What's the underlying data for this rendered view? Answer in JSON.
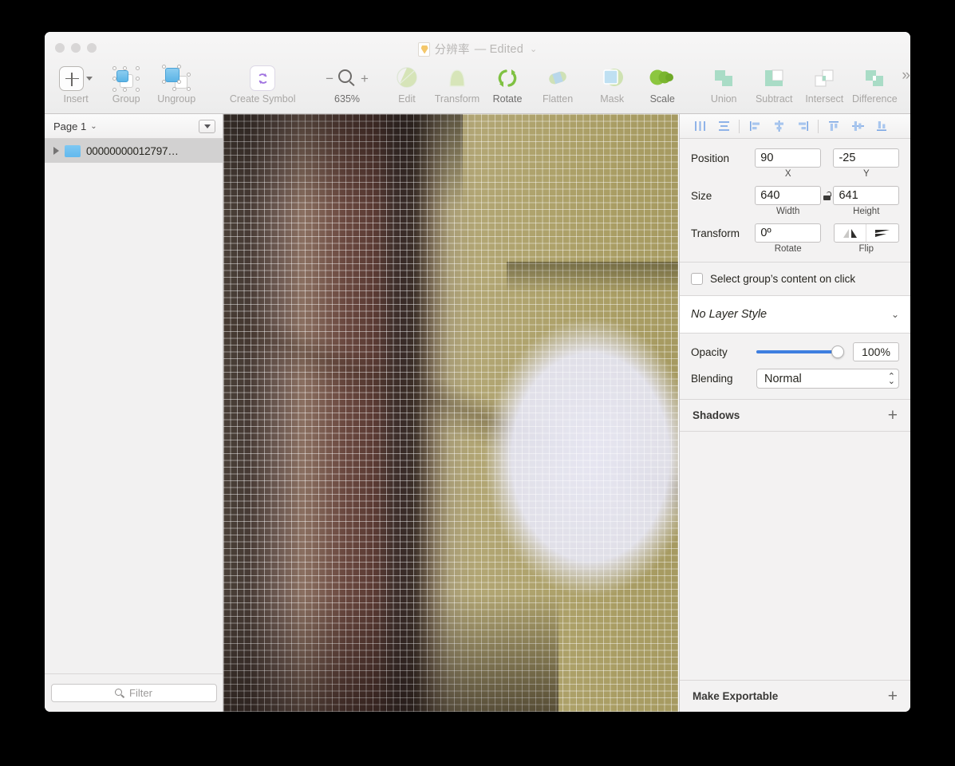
{
  "window": {
    "title": "分辨率",
    "title_suffix": "— Edited",
    "title_chevron": "⌄",
    "doc_icon": "sketch-document-icon"
  },
  "toolbar": {
    "items": [
      {
        "label": "Insert",
        "icon": "plus-icon",
        "enabled": false
      },
      {
        "label": "Group",
        "icon": "group-icon",
        "enabled": false
      },
      {
        "label": "Ungroup",
        "icon": "ungroup-icon",
        "enabled": false
      },
      {
        "label": "Create Symbol",
        "icon": "create-symbol-icon",
        "enabled": false
      },
      {
        "label": "Edit",
        "icon": "edit-icon",
        "enabled": false
      },
      {
        "label": "Transform",
        "icon": "transform-icon",
        "enabled": false
      },
      {
        "label": "Rotate",
        "icon": "rotate-icon",
        "enabled": true
      },
      {
        "label": "Flatten",
        "icon": "flatten-icon",
        "enabled": false
      },
      {
        "label": "Mask",
        "icon": "mask-icon",
        "enabled": false
      },
      {
        "label": "Scale",
        "icon": "scale-icon",
        "enabled": true
      },
      {
        "label": "Union",
        "icon": "union-icon",
        "enabled": false
      },
      {
        "label": "Subtract",
        "icon": "subtract-icon",
        "enabled": false
      },
      {
        "label": "Intersect",
        "icon": "intersect-icon",
        "enabled": false
      },
      {
        "label": "Difference",
        "icon": "difference-icon",
        "enabled": false
      }
    ],
    "zoom": {
      "minus": "−",
      "plus": "+",
      "icon": "magnifier-icon",
      "level": "635%"
    },
    "overflow": "»"
  },
  "sidebar": {
    "page": {
      "name": "Page 1",
      "chevron": "⌄"
    },
    "page_options_icon": "page-options-icon",
    "layers": [
      {
        "name": "00000000012797…",
        "icon": "folder-icon",
        "disclosure": "collapsed",
        "selected": true
      }
    ],
    "filter": {
      "placeholder": "Filter",
      "value": "",
      "icon": "search-icon"
    }
  },
  "inspector": {
    "align_tools": [
      "distribute-horizontally-icon",
      "distribute-vertically-icon",
      "align-left-icon",
      "align-center-icon",
      "align-right-icon",
      "align-top-icon",
      "align-middle-icon",
      "align-bottom-icon"
    ],
    "position": {
      "label": "Position",
      "x": {
        "value": "90",
        "sublabel": "X"
      },
      "y": {
        "value": "-25",
        "sublabel": "Y"
      }
    },
    "size": {
      "label": "Size",
      "width": {
        "value": "640",
        "sublabel": "Width"
      },
      "height": {
        "value": "641",
        "sublabel": "Height"
      },
      "lock_icon": "proportion-unlock-icon"
    },
    "transform": {
      "label": "Transform",
      "rotate": {
        "value": "0º",
        "sublabel": "Rotate"
      },
      "flip": {
        "sublabel": "Flip",
        "horizontal_icon": "flip-horizontal-icon",
        "vertical_icon": "flip-vertical-icon"
      }
    },
    "select_group": {
      "label": "Select group’s content on click",
      "checked": false
    },
    "layer_style": {
      "value": "No Layer Style",
      "chevron": "⌄"
    },
    "opacity": {
      "label": "Opacity",
      "value": "100%",
      "percent": 100,
      "accent": "#3f7fe0"
    },
    "blending": {
      "label": "Blending",
      "value": "Normal"
    },
    "shadows": {
      "label": "Shadows",
      "add": "+"
    },
    "make_exportable": {
      "label": "Make Exportable",
      "add": "+"
    }
  },
  "canvas": {
    "name": "zoomed-pixelated-photo",
    "zoom_level": "635%",
    "description": "Heavily magnified bitmap with per-pixel grid overlay"
  }
}
